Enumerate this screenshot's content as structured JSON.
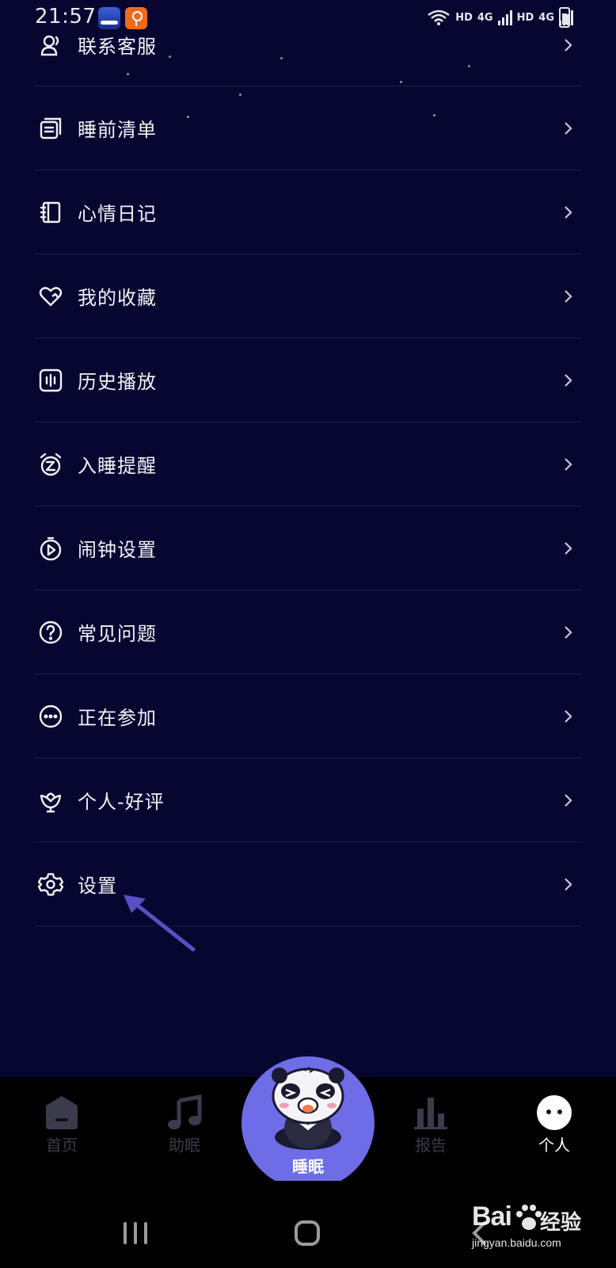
{
  "status_bar": {
    "time": "21:57",
    "network_label_1": "HD",
    "network_gen_1": "4G",
    "network_label_2": "HD",
    "network_gen_2": "4G"
  },
  "menu": {
    "items": [
      {
        "label": "联系客服",
        "icon": "headset-user-icon"
      },
      {
        "label": "睡前清单",
        "icon": "checklist-icon"
      },
      {
        "label": "心情日记",
        "icon": "notebook-icon"
      },
      {
        "label": "我的收藏",
        "icon": "heart-icon"
      },
      {
        "label": "历史播放",
        "icon": "audio-history-icon"
      },
      {
        "label": "入睡提醒",
        "icon": "alarm-z-icon"
      },
      {
        "label": "闹钟设置",
        "icon": "timer-play-icon"
      },
      {
        "label": "常见问题",
        "icon": "question-icon"
      },
      {
        "label": "正在参加",
        "icon": "ellipsis-circle-icon"
      },
      {
        "label": "个人-好评",
        "icon": "flower-icon"
      },
      {
        "label": "设置",
        "icon": "gear-icon"
      }
    ]
  },
  "bottom_nav": {
    "home": "首页",
    "sleep_aid": "助眠",
    "center": "睡眠",
    "report": "报告",
    "me": "个人",
    "active": "me"
  },
  "watermark": {
    "brand": "Bai",
    "brand_cn": "经验",
    "url": "jingyan.baidu.com"
  },
  "colors": {
    "background": "#060630",
    "accent": "#6f6ce8",
    "annotation_arrow": "#5a4fc4"
  }
}
